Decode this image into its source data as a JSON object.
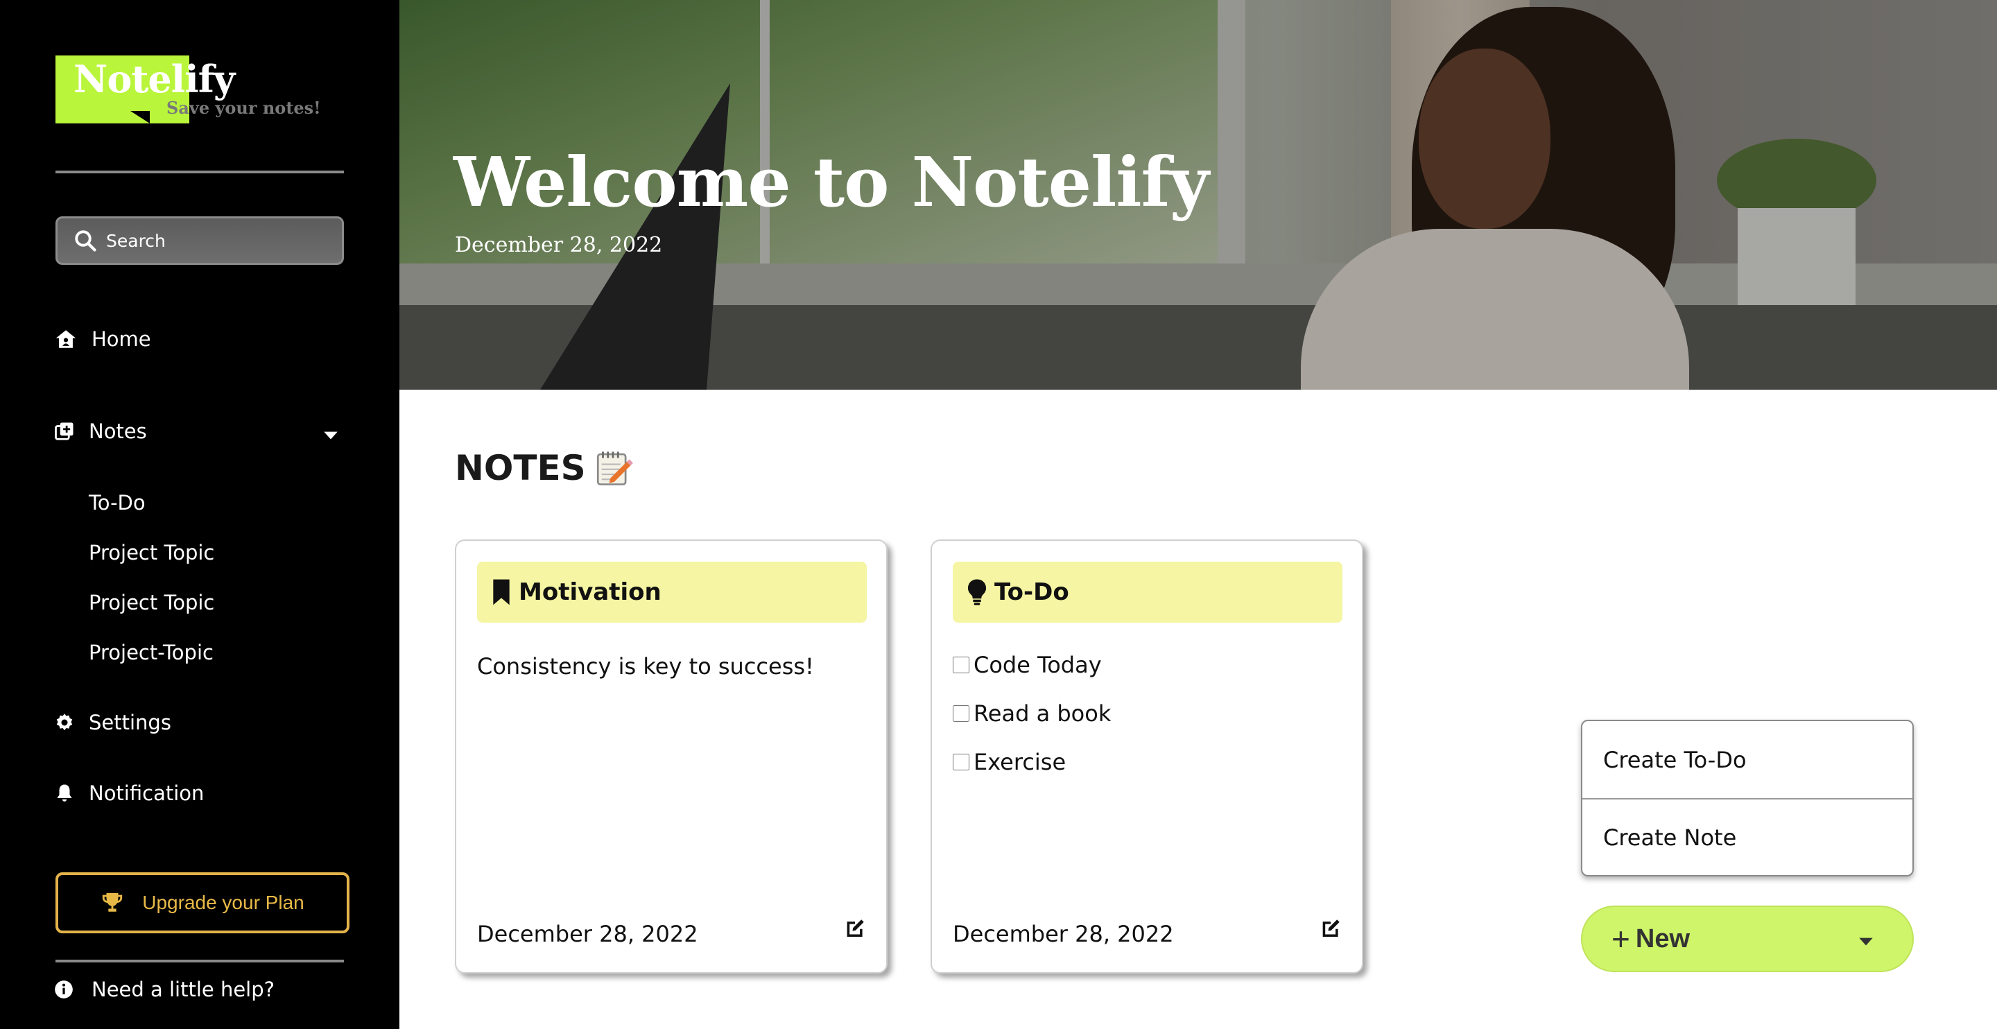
{
  "brand": {
    "name": "Notelify",
    "tagline": "Save your notes!",
    "accent_color": "#b9f53a"
  },
  "sidebar": {
    "search": {
      "placeholder": "Search"
    },
    "nav": {
      "home": {
        "label": "Home",
        "icon": "home-icon"
      },
      "notes": {
        "label": "Notes",
        "icon": "notes-icon",
        "expanded": true,
        "children": [
          "To-Do",
          "Project Topic",
          "Project Topic",
          "Project-Topic"
        ]
      },
      "settings": {
        "label": "Settings",
        "icon": "gear-icon"
      },
      "notification": {
        "label": "Notification",
        "icon": "bell-icon"
      }
    },
    "upgrade": {
      "label": "Upgrade your Plan",
      "icon": "trophy-icon",
      "color": "#e8b947"
    },
    "help": {
      "label": "Need a little help?",
      "icon": "info-icon"
    }
  },
  "hero": {
    "title": "Welcome to Notelify",
    "date": "December 28, 2022"
  },
  "notes_section": {
    "title": "NOTES",
    "icon": "memo-icon",
    "cards": [
      {
        "title": "Motivation",
        "icon": "bookmark-icon",
        "body": "Consistency is key to success!",
        "date": "December 28, 2022"
      },
      {
        "title": "To-Do",
        "icon": "lightbulb-icon",
        "items": [
          {
            "label": "Code Today",
            "checked": false
          },
          {
            "label": "Read a book",
            "checked": false
          },
          {
            "label": "Exercise",
            "checked": false
          }
        ],
        "date": "December 28, 2022"
      }
    ],
    "card_header_color": "#f5f5a3"
  },
  "new_menu": {
    "items": [
      "Create To-Do",
      "Create Note"
    ],
    "button_label": "New",
    "button_color": "#cff56a",
    "open": true
  }
}
